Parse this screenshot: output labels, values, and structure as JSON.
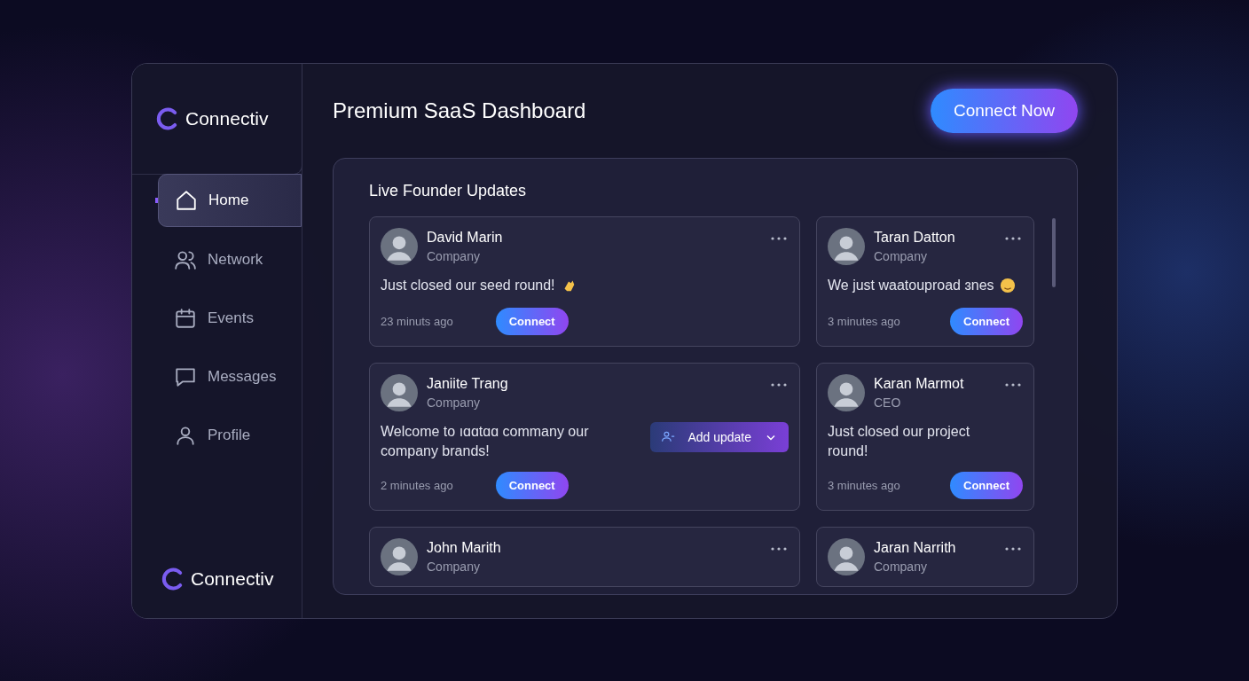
{
  "brand": {
    "name": "Connectiv"
  },
  "sidebar": {
    "items": [
      {
        "label": "Home",
        "selected": true
      },
      {
        "label": "Network",
        "selected": false
      },
      {
        "label": "Events",
        "selected": false
      },
      {
        "label": "Messages",
        "selected": false
      },
      {
        "label": "Profile",
        "selected": false
      }
    ],
    "footer_brand": "Connectiv"
  },
  "header": {
    "title": "Premium SaaS Dashboard",
    "cta": "Connect Now"
  },
  "feed": {
    "title": "Live Founder Updates",
    "cards": [
      {
        "name": "David Marin",
        "role": "Company",
        "message": "Just closed our seed round!",
        "kind": "clap",
        "time": "23 minuts ago",
        "button": "Connect"
      },
      {
        "name": "Taran Datton",
        "role": "Company",
        "message": "We just waatouproad ɜnes",
        "kind": "face",
        "time": "3 minutes ago",
        "button": "Connect"
      },
      {
        "name": "Janiite Trang",
        "role": "Company",
        "message": "Welcome to ıɑɑtɑɑ commany our company brands!",
        "time": "2 minutes ago",
        "button": "Connect",
        "action": "Add update"
      },
      {
        "name": "Karan Marmot",
        "role": "CEO",
        "message": "Just closed our project round!",
        "time": "3 minutes ago",
        "button": "Connect"
      },
      {
        "name": "John Marith",
        "role": "Company"
      },
      {
        "name": "Jaran Narrith",
        "role": "Company"
      }
    ]
  }
}
